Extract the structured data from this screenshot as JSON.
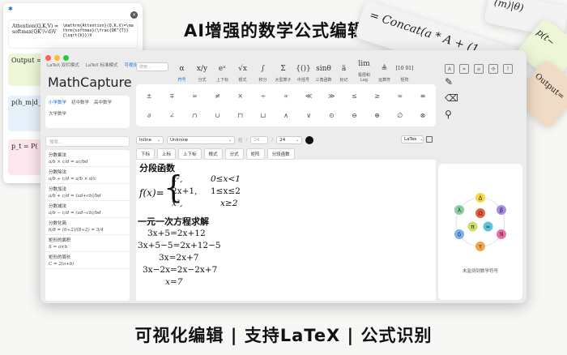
{
  "headline": "AI增强的数学公式编辑器",
  "tagline": "可视化编辑 | 支持LaTeX | 公式识别",
  "bg_window": {
    "cards": [
      {
        "text": "Attention(Q,K,V) = softmax(QKᵀ/√d)V",
        "code": "\\mathrm{Attention}(Q,K,V)=\\mathrm{softmax}(\\frac{QK^{T}}{\\sqrt{k}})V",
        "bg": "#ffffff"
      },
      {
        "text": "Output = Concat(",
        "bg": "#eef6d8"
      },
      {
        "text": "p(h_m|d_i) = Σ",
        "bg": "#e7f1fb"
      },
      {
        "text": "p_t = P(",
        "bg": "#fde7ee"
      }
    ]
  },
  "tilt_cards": [
    {
      "text": "= Concat(a * A + (1",
      "tail": "(m)|θ)",
      "bg": "#f3f3f3"
    },
    {
      "text": "p(t−",
      "bg": "#eef6d8"
    },
    {
      "text": "Output=",
      "bg": "#f0dcc6"
    }
  ],
  "window": {
    "nav": [
      "LaTeX 双栏模式",
      "LaTeX 标准模式",
      "可视化模式"
    ],
    "title": "MathCapture",
    "grades": [
      "小学数学",
      "初中数学",
      "高中数学"
    ],
    "grade_extra": "大学数学",
    "search_placeholder": "搜索...",
    "list": [
      {
        "label": "分数乘法",
        "formula": "a/b × c/d = ac/bd"
      },
      {
        "label": "分数除法",
        "formula": "a/b ÷ c/d = a/b × d/c"
      },
      {
        "label": "分数加法",
        "formula": "a/b + c/d = (ad+cb)/bd"
      },
      {
        "label": "分数减法",
        "formula": "a/b − c/d = (ad−cb)/bd"
      },
      {
        "label": "分数化简",
        "formula": "6/8 = (6÷2)/(8÷2) = 3/4"
      },
      {
        "label": "矩形的面积",
        "formula": "S = a×b"
      },
      {
        "label": "矩形的周长",
        "formula": "C = 2(a+b)"
      }
    ]
  },
  "toolbar": {
    "search_placeholder": "搜索...",
    "items": [
      {
        "glyph": "α",
        "label": "符号"
      },
      {
        "glyph": "x/y",
        "label": "分式"
      },
      {
        "glyph": "eˣ",
        "label": "上下标"
      },
      {
        "glyph": "√x",
        "label": "根式"
      },
      {
        "glyph": "∫",
        "label": "积分"
      },
      {
        "glyph": "Σ",
        "label": "大型算子"
      },
      {
        "glyph": "{()}",
        "label": "中括号"
      },
      {
        "glyph": "sinθ",
        "label": "三角函数"
      },
      {
        "glyph": "ä",
        "label": "标记"
      },
      {
        "glyph": "lim",
        "label": "极限和 Log"
      },
      {
        "glyph": "≜",
        "label": "运算符"
      },
      {
        "glyph": "[10 01]",
        "label": "矩阵"
      }
    ]
  },
  "symbols": [
    "±",
    "∓",
    "∞",
    "≠",
    "×",
    "÷",
    "∝",
    "≪",
    "≫",
    "≤",
    "≥",
    "≈",
    "≡",
    "∂",
    "∠",
    "∩",
    "∪",
    "⊓",
    "⊔",
    "∧",
    "∨",
    "⊙",
    "⊖",
    "⊕",
    "∅",
    "⊗"
  ],
  "controls": {
    "display_mode": "Inline",
    "font": "Unknow",
    "size_label_a": "粗",
    "size_a": "24",
    "size_b": "24",
    "output": "LaTex"
  },
  "buttons": [
    "下标",
    "上标",
    "上下标",
    "根式",
    "分式",
    "矩阵",
    "分段函数"
  ],
  "editor": {
    "heading1": "分段函数",
    "fx": "f(x)=",
    "cases": [
      [
        "x²,",
        "0≤x<1"
      ],
      [
        "2x+1,",
        "1≤x≤2"
      ],
      [
        "x³,",
        "x≥2"
      ]
    ],
    "heading2": "一元一次方程求解",
    "steps": [
      "3x+5=2x+12",
      "3x+5−5=2x+12−5",
      "3x=2x+7",
      "3x−2x=2x−2x+7",
      "x=7"
    ]
  },
  "canvas": {
    "label": "未监测到数学符号",
    "nodes": [
      "Δ",
      "β",
      "ℜ",
      "τ",
      "δ",
      "λ",
      "Ω",
      "∞",
      "π"
    ]
  },
  "colors": {
    "accent": "#1b6fd6"
  }
}
